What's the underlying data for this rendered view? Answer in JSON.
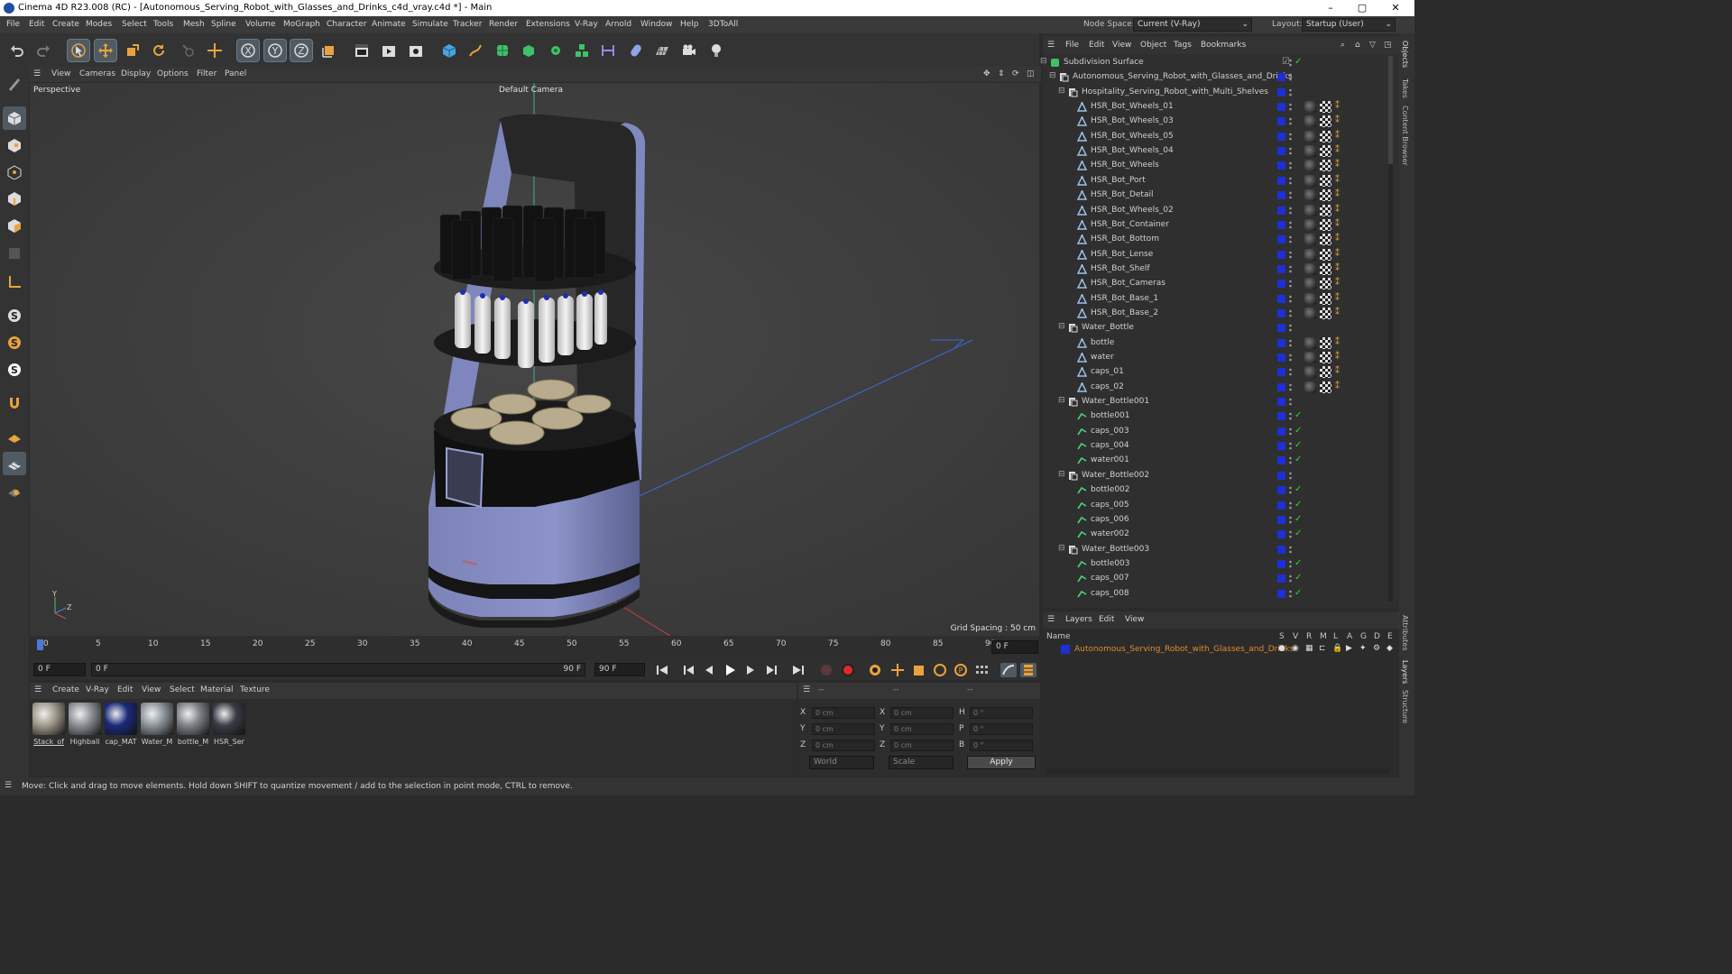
{
  "window": {
    "title": "Cinema 4D R23.008 (RC) - [Autonomous_Serving_Robot_with_Glasses_and_Drinks_c4d_vray.c4d *] - Main",
    "minimize": "–",
    "maximize": "▢",
    "close": "✕"
  },
  "menu": {
    "items": [
      "File",
      "Edit",
      "Create",
      "Modes",
      "Select",
      "Tools",
      "Mesh",
      "Spline",
      "Volume",
      "MoGraph",
      "Character",
      "Animate",
      "Simulate",
      "Tracker",
      "Render",
      "Extensions",
      "V-Ray",
      "Arnold",
      "Window",
      "Help",
      "3DToAll"
    ],
    "node_space_label": "Node Space:",
    "node_space_value": "Current (V-Ray)",
    "layout_label": "Layout:",
    "layout_value": "Startup (User)"
  },
  "viewport": {
    "menu": [
      "View",
      "Cameras",
      "Display",
      "Options",
      "Filter",
      "Panel"
    ],
    "label": "Perspective",
    "camera": "Default Camera",
    "grid_spacing": "Grid Spacing : 50 cm"
  },
  "timeline": {
    "ticks": [
      "0",
      "5",
      "10",
      "15",
      "20",
      "25",
      "30",
      "35",
      "40",
      "45",
      "50",
      "55",
      "60",
      "65",
      "70",
      "75",
      "80",
      "85",
      "90"
    ],
    "current_frame": "0 F",
    "start_field": "0 F",
    "range_start": "0 F",
    "range_end": "90 F",
    "end_field": "90 F"
  },
  "materials": {
    "menu": [
      "Create",
      "V-Ray",
      "Edit",
      "View",
      "Select",
      "Material",
      "Texture"
    ],
    "items": [
      {
        "name": "Stack_of",
        "color": "#a09a8c"
      },
      {
        "name": "Highball",
        "color": "#8a8f95"
      },
      {
        "name": "cap_MAT",
        "color": "#1b2a7a"
      },
      {
        "name": "Water_M",
        "color": "#8c949b"
      },
      {
        "name": "bottle_M",
        "color": "#7d8287"
      },
      {
        "name": "HSR_Ser",
        "color": "#3a3c46"
      }
    ]
  },
  "coords": {
    "headers": [
      "--",
      "--",
      "--"
    ],
    "rows": [
      {
        "a": "X",
        "av": "0 cm",
        "b": "X",
        "bv": "0 cm",
        "c": "H",
        "cv": "0 °"
      },
      {
        "a": "Y",
        "av": "0 cm",
        "b": "Y",
        "bv": "0 cm",
        "c": "P",
        "cv": "0 °"
      },
      {
        "a": "Z",
        "av": "0 cm",
        "b": "Z",
        "bv": "0 cm",
        "c": "B",
        "cv": "0 °"
      }
    ],
    "world": "World",
    "scale": "Scale",
    "apply": "Apply"
  },
  "objects": {
    "menu": [
      "File",
      "Edit",
      "View",
      "Object",
      "Tags",
      "Bookmarks"
    ],
    "rows": [
      {
        "name": "Subdivision Surface",
        "depth": 0,
        "type": "sub"
      },
      {
        "name": "Autonomous_Serving_Robot_with_Glasses_and_Drinks",
        "depth": 1,
        "type": "null"
      },
      {
        "name": "Hospitality_Serving_Robot_with_Multi_Shelves",
        "depth": 2,
        "type": "null"
      },
      {
        "name": "HSR_Bot_Wheels_01",
        "depth": 3,
        "type": "mesh",
        "tags": true
      },
      {
        "name": "HSR_Bot_Wheels_03",
        "depth": 3,
        "type": "mesh",
        "tags": true
      },
      {
        "name": "HSR_Bot_Wheels_05",
        "depth": 3,
        "type": "mesh",
        "tags": true
      },
      {
        "name": "HSR_Bot_Wheels_04",
        "depth": 3,
        "type": "mesh",
        "tags": true
      },
      {
        "name": "HSR_Bot_Wheels",
        "depth": 3,
        "type": "mesh",
        "tags": true
      },
      {
        "name": "HSR_Bot_Port",
        "depth": 3,
        "type": "mesh",
        "tags": true
      },
      {
        "name": "HSR_Bot_Detail",
        "depth": 3,
        "type": "mesh",
        "tags": true
      },
      {
        "name": "HSR_Bot_Wheels_02",
        "depth": 3,
        "type": "mesh",
        "tags": true
      },
      {
        "name": "HSR_Bot_Container",
        "depth": 3,
        "type": "mesh",
        "tags": true
      },
      {
        "name": "HSR_Bot_Bottom",
        "depth": 3,
        "type": "mesh",
        "tags": true
      },
      {
        "name": "HSR_Bot_Lense",
        "depth": 3,
        "type": "mesh",
        "tags": true
      },
      {
        "name": "HSR_Bot_Shelf",
        "depth": 3,
        "type": "mesh",
        "tags": true
      },
      {
        "name": "HSR_Bot_Cameras",
        "depth": 3,
        "type": "mesh",
        "tags": true
      },
      {
        "name": "HSR_Bot_Base_1",
        "depth": 3,
        "type": "mesh",
        "tags": true
      },
      {
        "name": "HSR_Bot_Base_2",
        "depth": 3,
        "type": "mesh",
        "tags": true
      },
      {
        "name": "Water_Bottle",
        "depth": 2,
        "type": "null"
      },
      {
        "name": "bottle",
        "depth": 3,
        "type": "mesh",
        "tags": true
      },
      {
        "name": "water",
        "depth": 3,
        "type": "mesh",
        "tags": true
      },
      {
        "name": "caps_01",
        "depth": 3,
        "type": "mesh",
        "tags": true
      },
      {
        "name": "caps_02",
        "depth": 3,
        "type": "mesh",
        "tags": true
      },
      {
        "name": "Water_Bottle001",
        "depth": 2,
        "type": "null"
      },
      {
        "name": "bottle001",
        "depth": 3,
        "type": "inst",
        "check": true
      },
      {
        "name": "caps_003",
        "depth": 3,
        "type": "inst",
        "check": true
      },
      {
        "name": "caps_004",
        "depth": 3,
        "type": "inst",
        "check": true
      },
      {
        "name": "water001",
        "depth": 3,
        "type": "inst",
        "check": true
      },
      {
        "name": "Water_Bottle002",
        "depth": 2,
        "type": "null"
      },
      {
        "name": "bottle002",
        "depth": 3,
        "type": "inst",
        "check": true
      },
      {
        "name": "caps_005",
        "depth": 3,
        "type": "inst",
        "check": true
      },
      {
        "name": "caps_006",
        "depth": 3,
        "type": "inst",
        "check": true
      },
      {
        "name": "water002",
        "depth": 3,
        "type": "inst",
        "check": true
      },
      {
        "name": "Water_Bottle003",
        "depth": 2,
        "type": "null"
      },
      {
        "name": "bottle003",
        "depth": 3,
        "type": "inst",
        "check": true
      },
      {
        "name": "caps_007",
        "depth": 3,
        "type": "inst",
        "check": true
      },
      {
        "name": "caps_008",
        "depth": 3,
        "type": "inst",
        "check": true
      }
    ]
  },
  "layers": {
    "menu": [
      "Layers",
      "Edit",
      "View"
    ],
    "name_header": "Name",
    "flags": [
      "S",
      "V",
      "R",
      "M",
      "L",
      "A",
      "G",
      "D",
      "E"
    ],
    "row_name": "Autonomous_Serving_Robot_with_Glasses_and_Drinks",
    "row_color": "#e08a2c"
  },
  "right_tabs": [
    "Objects",
    "Takes",
    "Content Browser",
    "Attributes",
    "Layers",
    "Structure"
  ],
  "status": "Move: Click and drag to move elements. Hold down SHIFT to quantize movement / add to the selection in point mode, CTRL to remove."
}
